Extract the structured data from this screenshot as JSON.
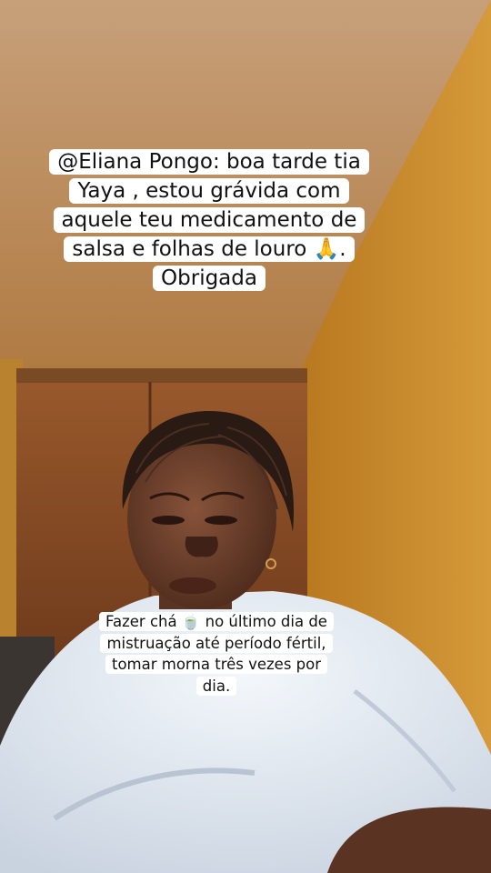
{
  "comment_caption": {
    "text": "@Eliana Pongo: boa tarde tia Yaya , estou grávida com aquele teu medicamento de salsa e folhas de louro 🙏. Obrigada"
  },
  "reply_caption": {
    "text": "Fazer chá 🍵 no último dia de mistruação até período fértil, tomar morna três vezes por dia."
  },
  "colors": {
    "ceiling": "#b98952",
    "wall": "#c98a35",
    "cabinet": "#8a4a22",
    "shirt": "#e8eef5",
    "skin": "#6b3f2a",
    "caption_bg": "#ffffff"
  }
}
